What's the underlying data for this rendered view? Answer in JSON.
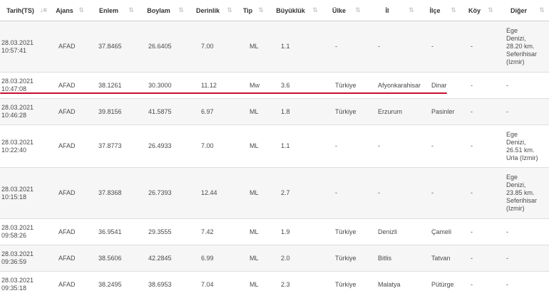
{
  "headers": [
    "Tarih(TS)",
    "Ajans",
    "Enlem",
    "Boylam",
    "Derinlik",
    "Tip",
    "Büyüklük",
    "Ülke",
    "İl",
    "İlçe",
    "Köy",
    "Diğer"
  ],
  "rows": [
    {
      "date": "28.03.2021",
      "time": "10:57:41",
      "agency": "AFAD",
      "lat": "37.8465",
      "lon": "26.6405",
      "depth": "7.00",
      "type": "ML",
      "mag": "1.1",
      "country": "-",
      "province": "-",
      "district": "-",
      "village": "-",
      "other": [
        "Ege",
        "Denizi,",
        "28.20 km.",
        "Seferihisar",
        "(Izmir)"
      ]
    },
    {
      "date": "28.03.2021",
      "time": "10:47:08",
      "agency": "AFAD",
      "lat": "38.1261",
      "lon": "30.3000",
      "depth": "11.12",
      "type": "Mw",
      "mag": "3.6",
      "country": "Türkiye",
      "province": "Afyonkarahisar",
      "district": "Dinar",
      "village": "-",
      "other": [
        "-"
      ]
    },
    {
      "date": "28.03.2021",
      "time": "10:46:28",
      "agency": "AFAD",
      "lat": "39.8156",
      "lon": "41.5875",
      "depth": "6.97",
      "type": "ML",
      "mag": "1.8",
      "country": "Türkiye",
      "province": "Erzurum",
      "district": "Pasinler",
      "village": "-",
      "other": [
        "-"
      ]
    },
    {
      "date": "28.03.2021",
      "time": "10:22:40",
      "agency": "AFAD",
      "lat": "37.8773",
      "lon": "26.4933",
      "depth": "7.00",
      "type": "ML",
      "mag": "1.1",
      "country": "-",
      "province": "-",
      "district": "-",
      "village": "-",
      "other": [
        "Ege",
        "Denizi,",
        "26.51 km.",
        "Urla (Izmir)"
      ]
    },
    {
      "date": "28.03.2021",
      "time": "10:15:18",
      "agency": "AFAD",
      "lat": "37.8368",
      "lon": "26.7393",
      "depth": "12.44",
      "type": "ML",
      "mag": "2.7",
      "country": "-",
      "province": "-",
      "district": "-",
      "village": "-",
      "other": [
        "Ege",
        "Denizi,",
        "23.85 km.",
        "Seferihisar",
        "(Izmir)"
      ]
    },
    {
      "date": "28.03.2021",
      "time": "09:58:26",
      "agency": "AFAD",
      "lat": "36.9541",
      "lon": "29.3555",
      "depth": "7.42",
      "type": "ML",
      "mag": "1.9",
      "country": "Türkiye",
      "province": "Denizli",
      "district": "Çameli",
      "village": "-",
      "other": [
        "-"
      ]
    },
    {
      "date": "28.03.2021",
      "time": "09:36:59",
      "agency": "AFAD",
      "lat": "38.5606",
      "lon": "42.2845",
      "depth": "6.99",
      "type": "ML",
      "mag": "2.0",
      "country": "Türkiye",
      "province": "Bitlis",
      "district": "Tatvan",
      "village": "-",
      "other": [
        "-"
      ]
    },
    {
      "date": "28.03.2021",
      "time": "09:35:18",
      "agency": "AFAD",
      "lat": "38.2495",
      "lon": "38.6953",
      "depth": "7.04",
      "type": "ML",
      "mag": "2.3",
      "country": "Türkiye",
      "province": "Malatya",
      "district": "Pütürge",
      "village": "-",
      "other": [
        "-"
      ]
    }
  ]
}
